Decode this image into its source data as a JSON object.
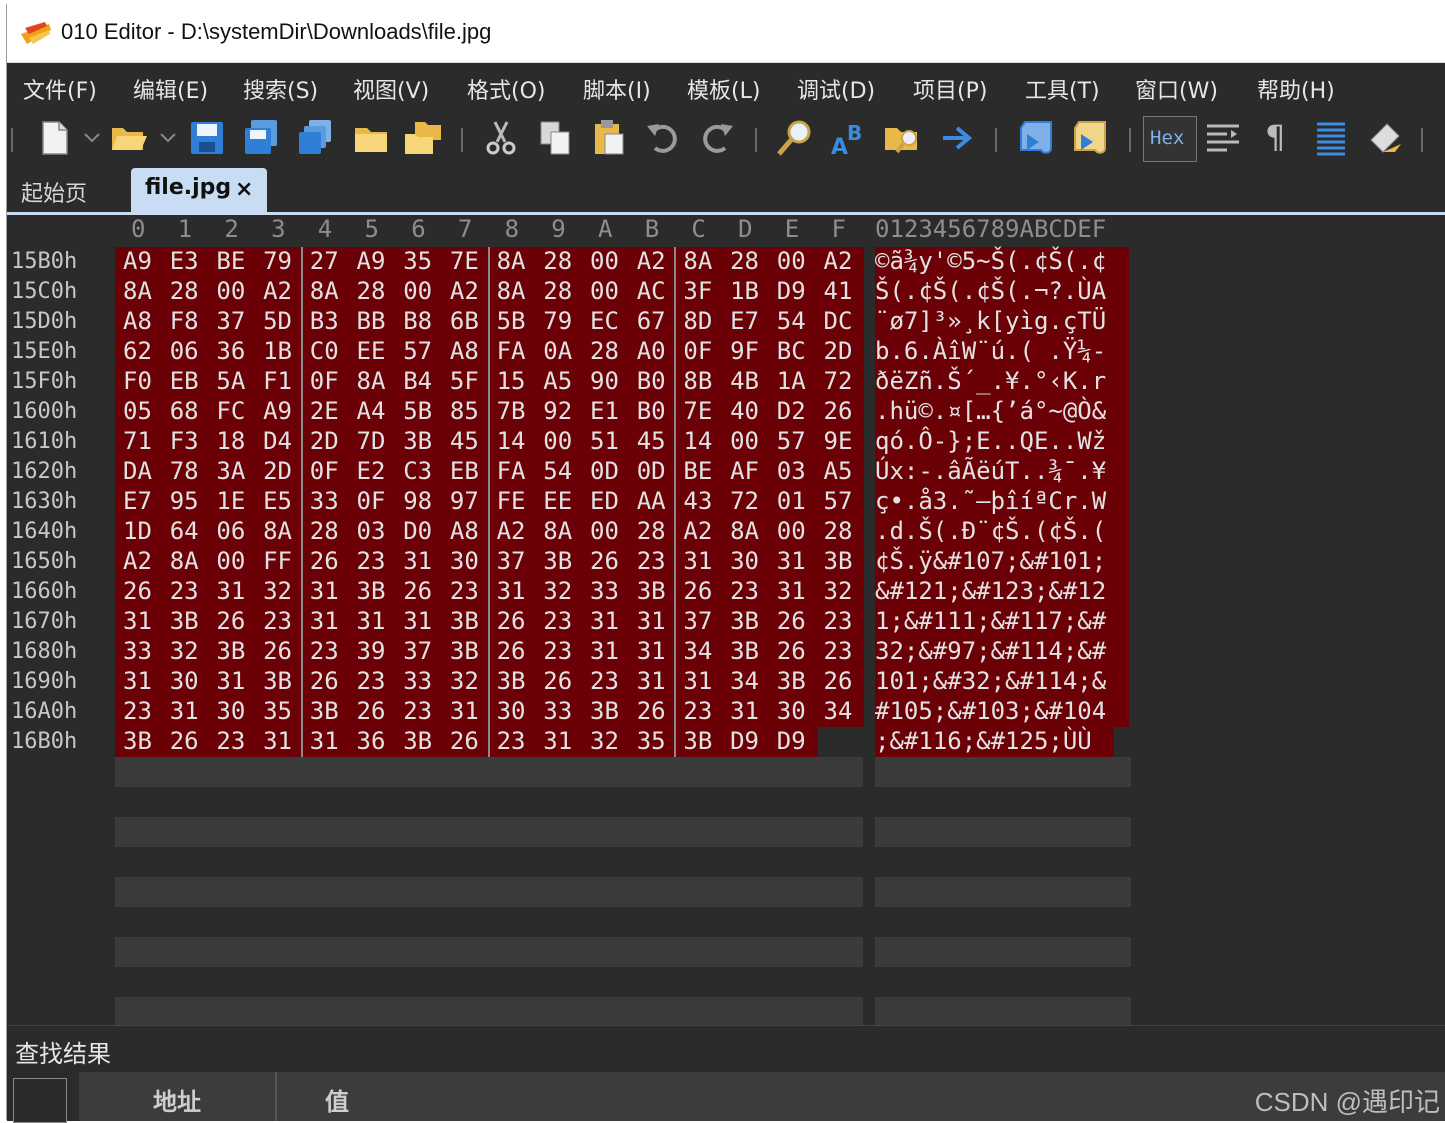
{
  "window": {
    "title": "010 Editor - D:\\systemDir\\Downloads\\file.jpg"
  },
  "menu": [
    "文件(F)",
    "编辑(E)",
    "搜索(S)",
    "视图(V)",
    "格式(O)",
    "脚本(I)",
    "模板(L)",
    "调试(D)",
    "项目(P)",
    "工具(T)",
    "窗口(W)",
    "帮助(H)"
  ],
  "toolbar": {
    "hex_label": "Hex",
    "pilcrow": "¶",
    "icons": [
      "new-file-icon",
      "open-folder-icon",
      "save-icon",
      "save-as-icon",
      "save-all-icon",
      "close-folder-icon",
      "close-all-icon",
      "cut-icon",
      "copy-icon",
      "paste-icon",
      "undo-icon",
      "redo-icon",
      "find-icon",
      "replace-icon",
      "find-in-files-icon",
      "goto-icon",
      "run-script-icon",
      "run-template-icon",
      "hex-mode-icon",
      "compare-icon",
      "show-whitespace-icon",
      "columns-icon",
      "highlight-icon"
    ]
  },
  "tabs": {
    "start": "起始页",
    "file": "file.jpg",
    "close": "×"
  },
  "hex": {
    "column_headers": [
      "0",
      "1",
      "2",
      "3",
      "4",
      "5",
      "6",
      "7",
      "8",
      "9",
      "A",
      "B",
      "C",
      "D",
      "E",
      "F"
    ],
    "text_header": "0123456789ABCDEF",
    "rows": [
      {
        "addr": "15B0h",
        "bytes": [
          "A9",
          "E3",
          "BE",
          "79",
          "27",
          "A9",
          "35",
          "7E",
          "8A",
          "28",
          "00",
          "A2",
          "8A",
          "28",
          "00",
          "A2"
        ],
        "text": "©ã¾y'©5~Š(.¢Š(.¢"
      },
      {
        "addr": "15C0h",
        "bytes": [
          "8A",
          "28",
          "00",
          "A2",
          "8A",
          "28",
          "00",
          "A2",
          "8A",
          "28",
          "00",
          "AC",
          "3F",
          "1B",
          "D9",
          "41"
        ],
        "text": "Š(.¢Š(.¢Š(.¬?.ÙA"
      },
      {
        "addr": "15D0h",
        "bytes": [
          "A8",
          "F8",
          "37",
          "5D",
          "B3",
          "BB",
          "B8",
          "6B",
          "5B",
          "79",
          "EC",
          "67",
          "8D",
          "E7",
          "54",
          "DC"
        ],
        "text": "¨ø7]³»¸k[yìg.çTÜ"
      },
      {
        "addr": "15E0h",
        "bytes": [
          "62",
          "06",
          "36",
          "1B",
          "C0",
          "EE",
          "57",
          "A8",
          "FA",
          "0A",
          "28",
          "A0",
          "0F",
          "9F",
          "BC",
          "2D"
        ],
        "text": "b.6.ÀîW¨ú.( .Ÿ¼-"
      },
      {
        "addr": "15F0h",
        "bytes": [
          "F0",
          "EB",
          "5A",
          "F1",
          "0F",
          "8A",
          "B4",
          "5F",
          "15",
          "A5",
          "90",
          "B0",
          "8B",
          "4B",
          "1A",
          "72"
        ],
        "text": "ðëZñ.Š´_.¥.°‹K.r"
      },
      {
        "addr": "1600h",
        "bytes": [
          "05",
          "68",
          "FC",
          "A9",
          "2E",
          "A4",
          "5B",
          "85",
          "7B",
          "92",
          "E1",
          "B0",
          "7E",
          "40",
          "D2",
          "26"
        ],
        "text": ".hü©.¤[…{’á°~@Ò&"
      },
      {
        "addr": "1610h",
        "bytes": [
          "71",
          "F3",
          "18",
          "D4",
          "2D",
          "7D",
          "3B",
          "45",
          "14",
          "00",
          "51",
          "45",
          "14",
          "00",
          "57",
          "9E"
        ],
        "text": "qó.Ô-};E..QE..Wž"
      },
      {
        "addr": "1620h",
        "bytes": [
          "DA",
          "78",
          "3A",
          "2D",
          "0F",
          "E2",
          "C3",
          "EB",
          "FA",
          "54",
          "0D",
          "0D",
          "BE",
          "AF",
          "03",
          "A5"
        ],
        "text": "Úx:-.âÃëúT..¾¯.¥"
      },
      {
        "addr": "1630h",
        "bytes": [
          "E7",
          "95",
          "1E",
          "E5",
          "33",
          "0F",
          "98",
          "97",
          "FE",
          "EE",
          "ED",
          "AA",
          "43",
          "72",
          "01",
          "57"
        ],
        "text": "ç•.å3.˜—þîíªCr.W"
      },
      {
        "addr": "1640h",
        "bytes": [
          "1D",
          "64",
          "06",
          "8A",
          "28",
          "03",
          "D0",
          "A8",
          "A2",
          "8A",
          "00",
          "28",
          "A2",
          "8A",
          "00",
          "28"
        ],
        "text": ".d.Š(.Ð¨¢Š.(¢Š.("
      },
      {
        "addr": "1650h",
        "bytes": [
          "A2",
          "8A",
          "00",
          "FF",
          "26",
          "23",
          "31",
          "30",
          "37",
          "3B",
          "26",
          "23",
          "31",
          "30",
          "31",
          "3B"
        ],
        "text": "¢Š.ÿ&#107;&#101;"
      },
      {
        "addr": "1660h",
        "bytes": [
          "26",
          "23",
          "31",
          "32",
          "31",
          "3B",
          "26",
          "23",
          "31",
          "32",
          "33",
          "3B",
          "26",
          "23",
          "31",
          "32"
        ],
        "text": "&#121;&#123;&#12"
      },
      {
        "addr": "1670h",
        "bytes": [
          "31",
          "3B",
          "26",
          "23",
          "31",
          "31",
          "31",
          "3B",
          "26",
          "23",
          "31",
          "31",
          "37",
          "3B",
          "26",
          "23"
        ],
        "text": "1;&#111;&#117;&#"
      },
      {
        "addr": "1680h",
        "bytes": [
          "33",
          "32",
          "3B",
          "26",
          "23",
          "39",
          "37",
          "3B",
          "26",
          "23",
          "31",
          "31",
          "34",
          "3B",
          "26",
          "23"
        ],
        "text": "32;&#97;&#114;&#"
      },
      {
        "addr": "1690h",
        "bytes": [
          "31",
          "30",
          "31",
          "3B",
          "26",
          "23",
          "33",
          "32",
          "3B",
          "26",
          "23",
          "31",
          "31",
          "34",
          "3B",
          "26"
        ],
        "text": "101;&#32;&#114;&"
      },
      {
        "addr": "16A0h",
        "bytes": [
          "23",
          "31",
          "30",
          "35",
          "3B",
          "26",
          "23",
          "31",
          "30",
          "33",
          "3B",
          "26",
          "23",
          "31",
          "30",
          "34"
        ],
        "text": "#105;&#103;&#104"
      },
      {
        "addr": "16B0h",
        "bytes": [
          "3B",
          "26",
          "23",
          "31",
          "31",
          "36",
          "3B",
          "26",
          "23",
          "31",
          "32",
          "35",
          "3B",
          "D9",
          "D9"
        ],
        "text": ";&#116;&#125;ÙÙ"
      }
    ]
  },
  "find_panel": {
    "title": "查找结果",
    "col_address": "地址",
    "col_value": "值"
  },
  "watermark": "CSDN @遇印记",
  "colors": {
    "selection": "#6b0006",
    "background": "#2b2b2b",
    "tab_active": "#c8ddf3"
  }
}
